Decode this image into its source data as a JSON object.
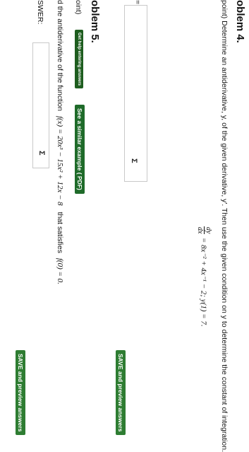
{
  "problem4": {
    "title": "oblem 4.",
    "prompt": "point) Determine an antiderivative, y, of the given derivative, y'. Then use the given condition on y to determine the constant of integration.",
    "dy": "dy",
    "dx": "dx",
    "equation": "= 8x⁻² + 4x⁻¹ − 2;   y(1) = 7.",
    "answer_label": "=",
    "sigma_icon": "Σ",
    "save_button": "SAVE and preview answers"
  },
  "problem5": {
    "title": "oblem 5.",
    "points_label": "oint)",
    "help_button": "Get help entering answers",
    "similar_button": "See a similar example ( PDF)",
    "prompt_prefix": "d the antiderivative of the function",
    "function": "f(x) = 20x³ − 15x² + 12x − 8",
    "prompt_suffix": "that satisfies",
    "condition": "f(0) = 0.",
    "answer_label": "SWER:",
    "sigma_icon": "Σ",
    "save_button": "SAVE and preview answers"
  }
}
